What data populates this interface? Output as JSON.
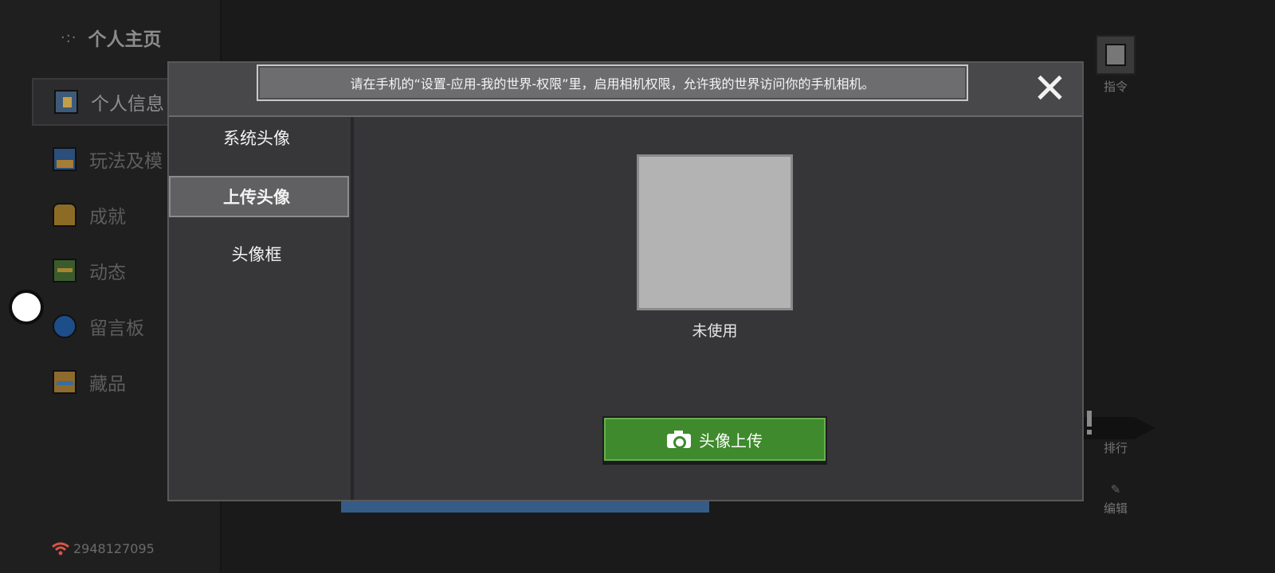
{
  "sidebar": {
    "back_title": "个人主页",
    "back_dots": "·:·",
    "items": [
      {
        "label": "个人信息",
        "icon": "profile-icon"
      },
      {
        "label": "玩法及模",
        "icon": "modes-icon"
      },
      {
        "label": "成就",
        "icon": "trophy-icon"
      },
      {
        "label": "动态",
        "icon": "feed-icon"
      },
      {
        "label": "留言板",
        "icon": "message-board-icon"
      },
      {
        "label": "藏品",
        "icon": "collection-icon"
      }
    ],
    "user_id": "2948127095"
  },
  "right_tools": {
    "command_label": "指令",
    "rank_label": "排行",
    "edit_label": "编辑"
  },
  "dialog": {
    "banner": "请在手机的“设置-应用-我的世界-权限”里，启用相机权限，允许我的世界访问你的手机相机。",
    "tabs": [
      {
        "label": "系统头像",
        "active": false
      },
      {
        "label": "上传头像",
        "active": true
      },
      {
        "label": "头像框",
        "active": false
      }
    ],
    "avatar_status": "未使用",
    "upload_button": "头像上传"
  },
  "colors": {
    "upload_green": "#3e8a2c",
    "dialog_bg": "#323234",
    "banner_bg": "#6d6d6f"
  }
}
